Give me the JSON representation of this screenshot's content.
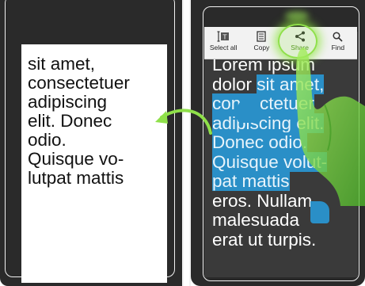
{
  "left_panel": {
    "text": "sit amet,\nconsectetuer\nadipiscing\nelit. Donec\nodio.\nQuisque vo-\nlutpat mattis"
  },
  "right_panel": {
    "lines": [
      {
        "plain": "Lorem ipsum",
        "selected": ""
      },
      {
        "plain": "dolor ",
        "selected": "sit amet,"
      },
      {
        "plain": "",
        "selected": "consectetuer"
      },
      {
        "plain": "",
        "selected": "adipiscing elit."
      },
      {
        "plain": "",
        "selected": "Donec odio."
      },
      {
        "plain": "",
        "selected": "Quisque volut-"
      },
      {
        "plain": "",
        "selected": "pat mattis"
      },
      {
        "plain": "eros. Nullam",
        "selected": ""
      },
      {
        "plain": "malesuada",
        "selected": ""
      },
      {
        "plain": "erat ut turpis.",
        "selected": ""
      }
    ]
  },
  "action_bar": {
    "select_all": "Select all",
    "copy": "Copy",
    "share": "Share",
    "find": "Find"
  },
  "colors": {
    "selection": "#2a8fc7",
    "accent_green": "#8fe04a",
    "device": "#2a2a2a"
  }
}
